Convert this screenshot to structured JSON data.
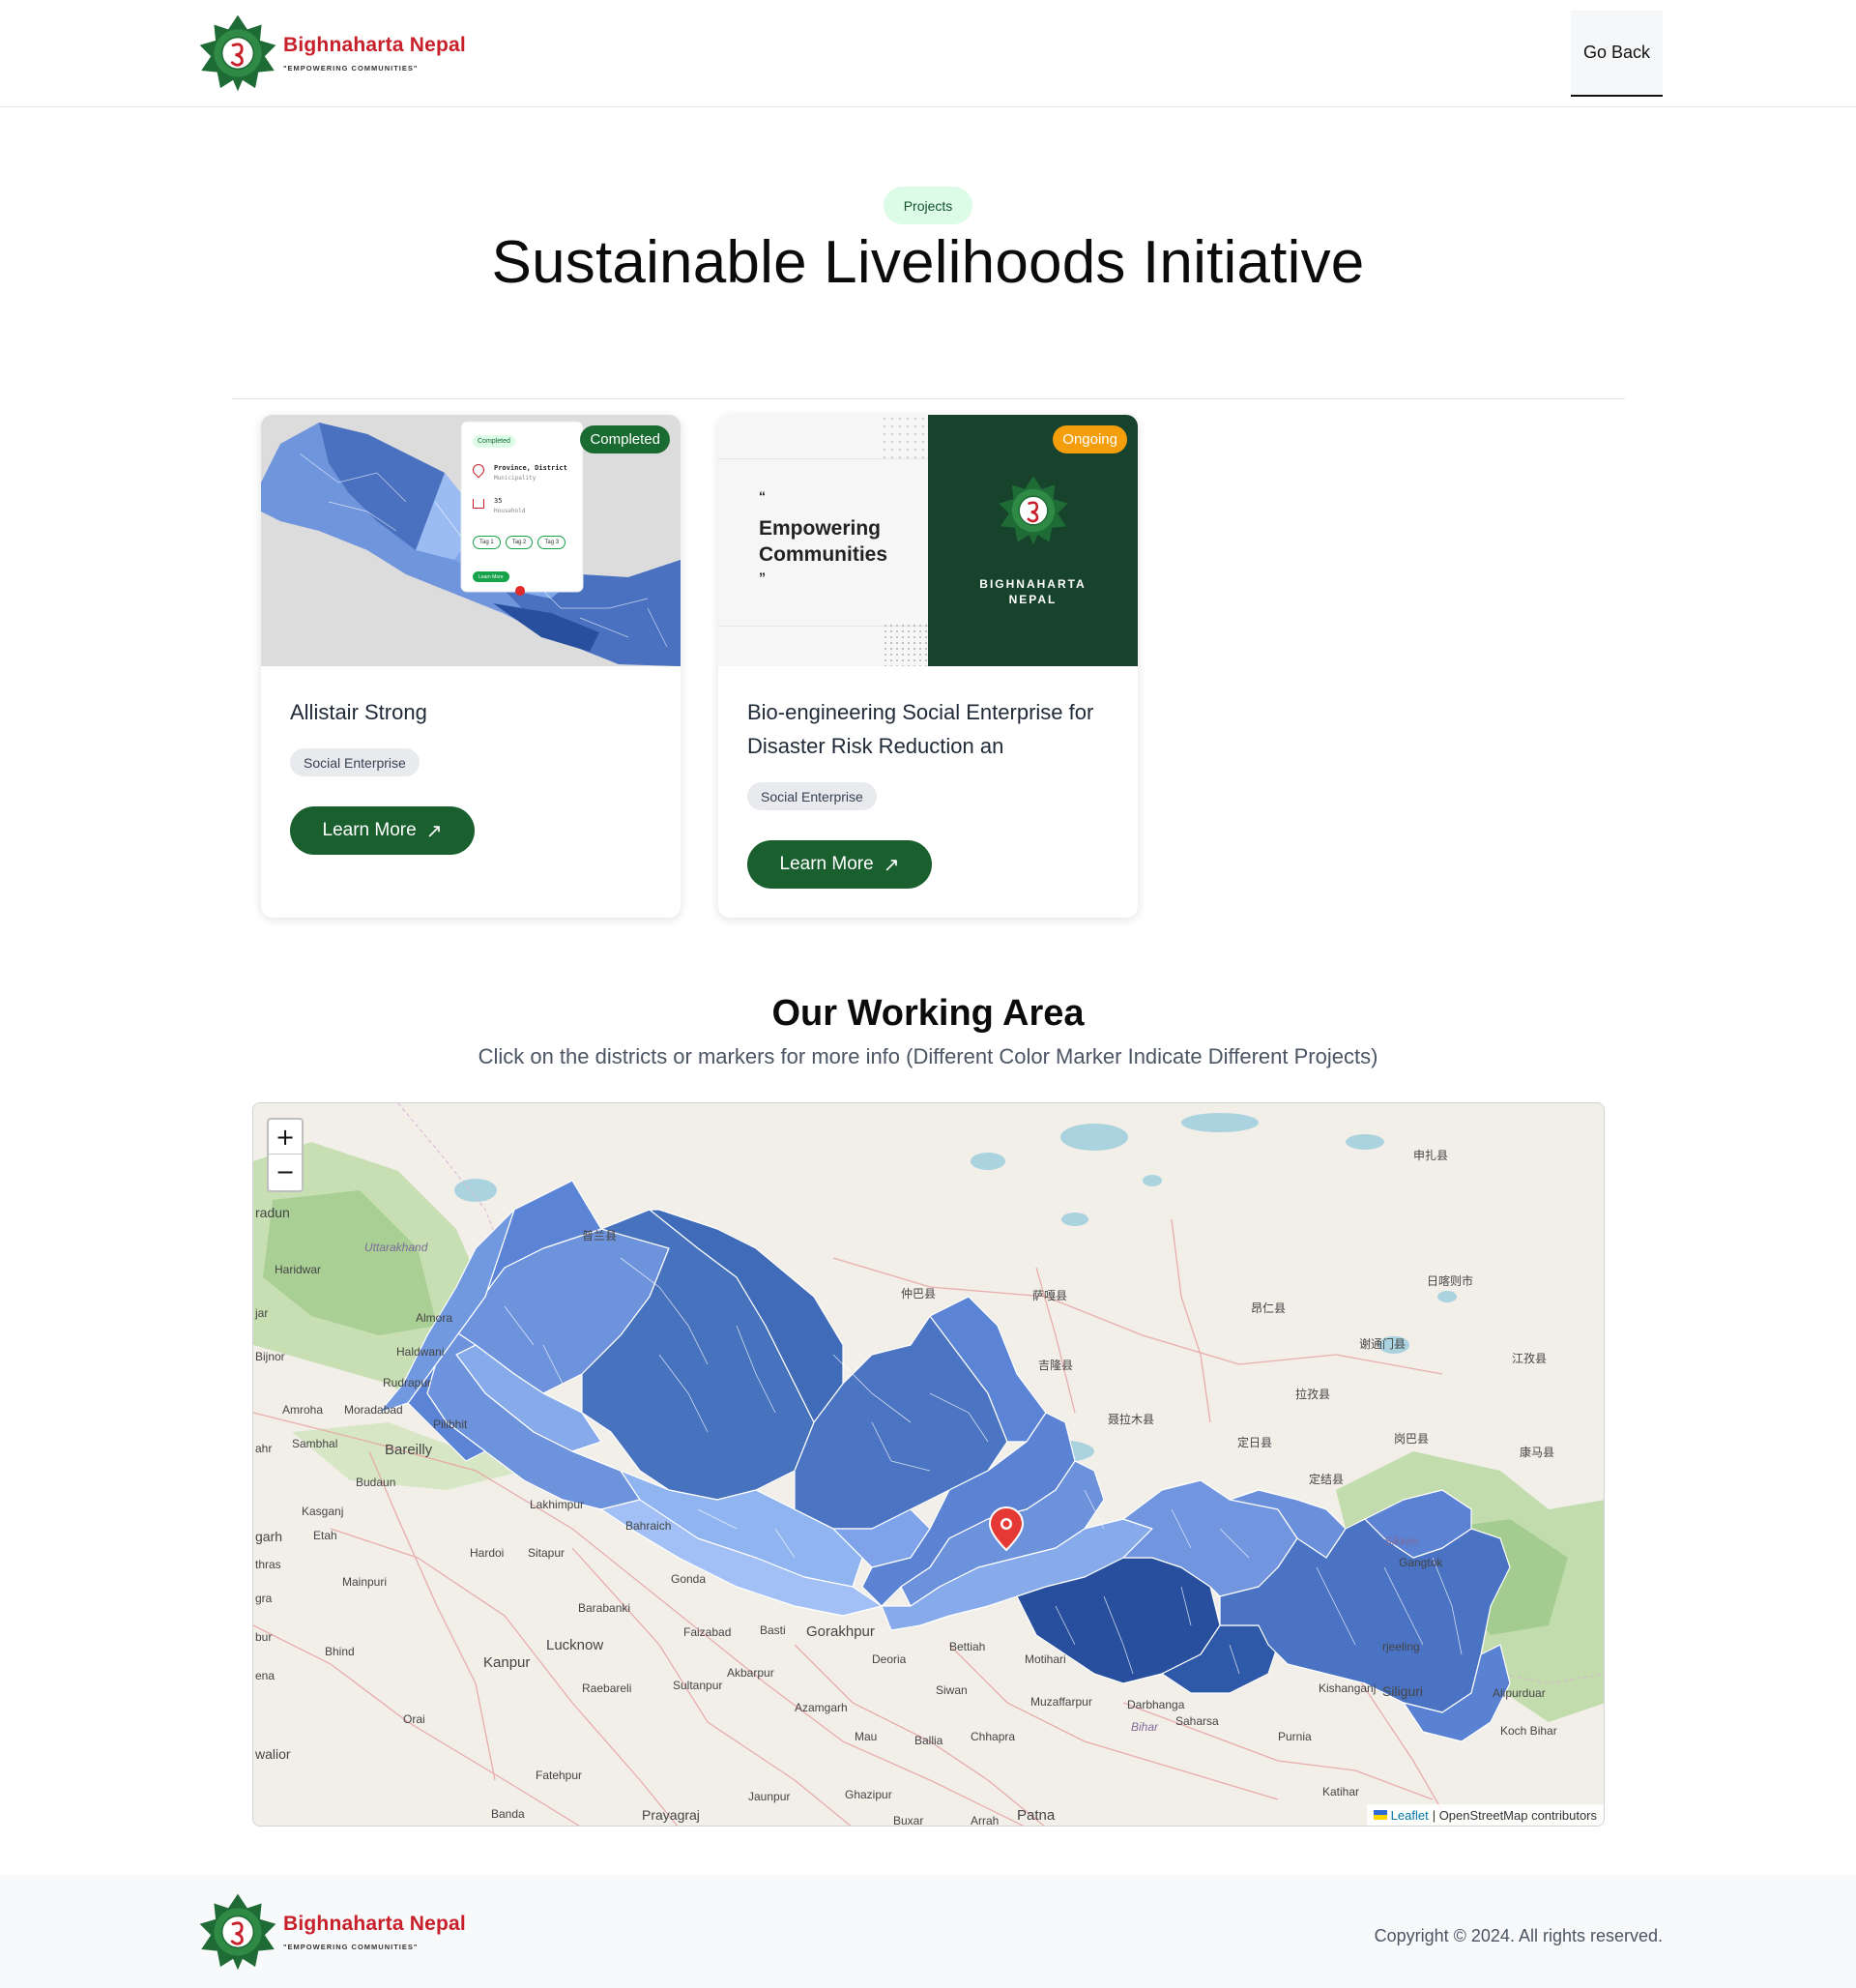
{
  "header": {
    "brand_name": "Bighnaharta Nepal",
    "brand_tagline": "\"EMPOWERING COMMUNITIES\"",
    "go_back_label": "Go Back"
  },
  "hero": {
    "pill": "Projects",
    "title": "Sustainable Livelihoods Initiative"
  },
  "cards": [
    {
      "status": "Completed",
      "status_color": "#1a6b31",
      "title": "Allistair Strong",
      "category": "Social Enterprise",
      "button_label": "Learn More",
      "thumb": {
        "mini_status": "Completed",
        "location": "Province, District",
        "municipality": "Municipality",
        "households": "35",
        "households_label": "Household",
        "tags": [
          "Tag 1",
          "Tag 2",
          "Tag 3"
        ],
        "mini_button": "Learn More"
      }
    },
    {
      "status": "Ongoing",
      "status_color": "#f59e0b",
      "title": "Bio-engineering Social Enterprise for Disaster Risk Reduction an",
      "category": "Social Enterprise",
      "button_label": "Learn More",
      "thumb": {
        "quote_open": "“",
        "quote_text_line1": "Empowering",
        "quote_text_line2": "Communities",
        "quote_close": "”",
        "brand_line1": "BIGHNAHARTA",
        "brand_line2": "NEPAL"
      }
    }
  ],
  "working_area": {
    "title": "Our Working Area",
    "subtitle": "Click on the districts or markers for more info (Different Color Marker Indicate Different Projects)",
    "zoom_in": "+",
    "zoom_out": "−",
    "attribution_leaflet": "Leaflet",
    "attribution_rest": "| OpenStreetMap contributors",
    "labels": [
      {
        "text": "radun"
      },
      {
        "text": "Uttarakhand"
      },
      {
        "text": "Haridwar"
      },
      {
        "text": "Almora"
      },
      {
        "text": "Haldwani"
      },
      {
        "text": "Bijnor"
      },
      {
        "text": "Rudrapur"
      },
      {
        "text": "Amroha"
      },
      {
        "text": "Moradabad"
      },
      {
        "text": "Pilibhit"
      },
      {
        "text": "Sambhal"
      },
      {
        "text": "Bareilly"
      },
      {
        "text": "Budaun"
      },
      {
        "text": "Kasganj"
      },
      {
        "text": "Etah"
      },
      {
        "text": "Lakhimpur"
      },
      {
        "text": "Bahraich"
      },
      {
        "text": "Hardoi"
      },
      {
        "text": "Sitapur"
      },
      {
        "text": "Mainpuri"
      },
      {
        "text": "Gonda"
      },
      {
        "text": "Barabanki"
      },
      {
        "text": "Faizabad"
      },
      {
        "text": "Basti"
      },
      {
        "text": "Gorakhpur"
      },
      {
        "text": "Bettiah"
      },
      {
        "text": "Lucknow"
      },
      {
        "text": "Kanpur"
      },
      {
        "text": "Bhind"
      },
      {
        "text": "Deoria"
      },
      {
        "text": "Motihari"
      },
      {
        "text": "Akbarpur"
      },
      {
        "text": "Raebareli"
      },
      {
        "text": "Sultanpur"
      },
      {
        "text": "Siwan"
      },
      {
        "text": "Muzaffarpur"
      },
      {
        "text": "Darbhanga"
      },
      {
        "text": "Azamgarh"
      },
      {
        "text": "Mau"
      },
      {
        "text": "Ballia"
      },
      {
        "text": "Chhapra"
      },
      {
        "text": "Bihar"
      },
      {
        "text": "Saharsa"
      },
      {
        "text": "Purnia"
      },
      {
        "text": "Kishanganj"
      },
      {
        "text": "Orai"
      },
      {
        "text": "Fatehpur"
      },
      {
        "text": "Jaunpur"
      },
      {
        "text": "Ghazipur"
      },
      {
        "text": "Buxar"
      },
      {
        "text": "Arrah"
      },
      {
        "text": "Patna"
      },
      {
        "text": "Banda"
      },
      {
        "text": "Prayagraj"
      },
      {
        "text": "Katihar"
      },
      {
        "text": "Siliguri"
      },
      {
        "text": "Alipurduar"
      },
      {
        "text": "Koch Bihar"
      },
      {
        "text": "Gangtok"
      },
      {
        "text": "Sikkim"
      },
      {
        "text": "rjeeling"
      },
      {
        "text": "仲巴县"
      },
      {
        "text": "萨嘎县"
      },
      {
        "text": "吉隆县"
      },
      {
        "text": "聂拉木县"
      },
      {
        "text": "定日县"
      },
      {
        "text": "定结县"
      },
      {
        "text": "昂仁县"
      },
      {
        "text": "谢通门县"
      },
      {
        "text": "拉孜县"
      },
      {
        "text": "岗巴县"
      },
      {
        "text": "日喀则市"
      },
      {
        "text": "江孜县"
      },
      {
        "text": "康马县"
      },
      {
        "text": "申扎县"
      },
      {
        "text": "普兰县"
      },
      {
        "text": "jar"
      },
      {
        "text": "ahr"
      },
      {
        "text": "garh"
      },
      {
        "text": "thras"
      },
      {
        "text": "gra"
      },
      {
        "text": "bur"
      },
      {
        "text": "ena"
      },
      {
        "text": "walior"
      }
    ]
  },
  "footer": {
    "brand_name": "Bighnaharta Nepal",
    "brand_tagline": "\"EMPOWERING COMMUNITIES\"",
    "copyright": "Copyright © 2024. All rights reserved."
  }
}
